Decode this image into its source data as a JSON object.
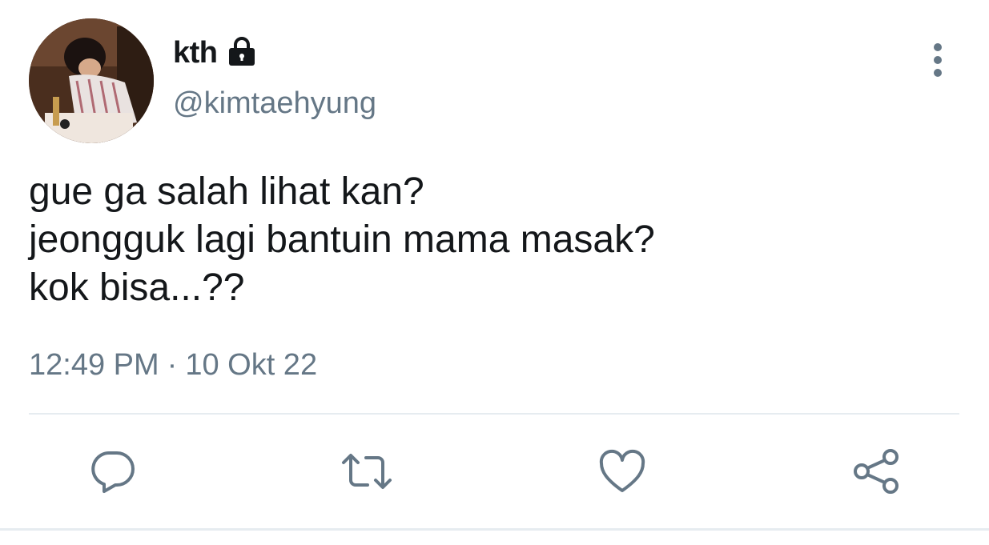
{
  "user": {
    "display_name": "kth",
    "handle": "@kimtaehyung",
    "protected_icon": "lock-icon",
    "avatar_icon": "profile-photo"
  },
  "tweet": {
    "text": "gue ga salah lihat kan?\njeongguk lagi bantuin mama masak?\nkok bisa...??",
    "time": "12:49 PM",
    "separator": "·",
    "date": "10 Okt 22"
  },
  "actions": {
    "reply_icon": "reply-icon",
    "retweet_icon": "retweet-icon",
    "like_icon": "heart-icon",
    "share_icon": "share-icon",
    "more_icon": "more-vertical-icon"
  },
  "colors": {
    "text_primary": "#14171a",
    "text_secondary": "#657786",
    "icon": "#657786",
    "divider": "#e6ecf0"
  }
}
